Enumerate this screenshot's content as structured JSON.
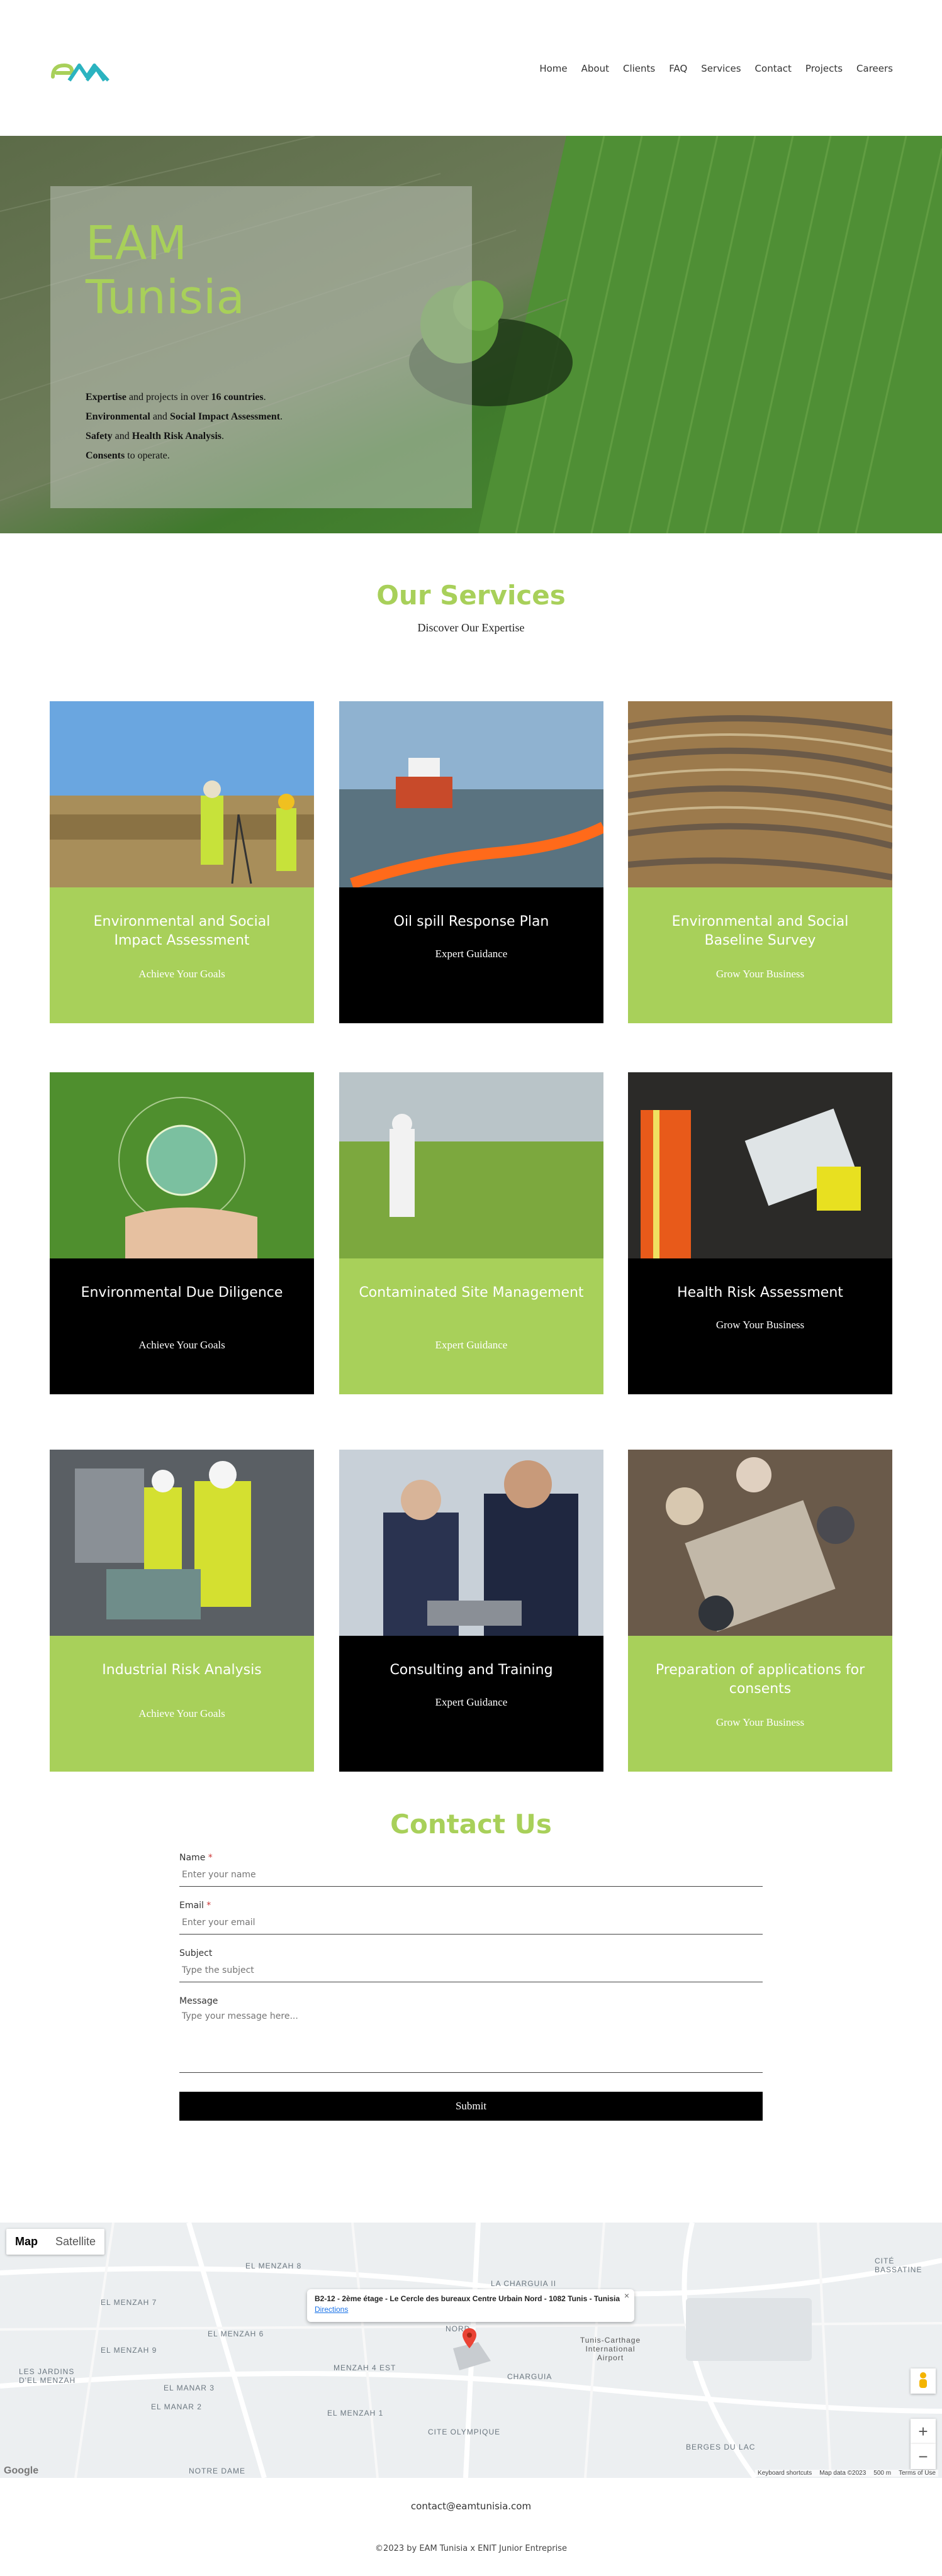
{
  "brand": {
    "logo_text": "EAM",
    "accent": "#a8d05a",
    "accent_blue": "#2bb3c0"
  },
  "nav": [
    "Home",
    "About",
    "Clients",
    "FAQ",
    "Services",
    "Contact",
    "Projects",
    "Careers"
  ],
  "hero": {
    "title_line1": "EAM",
    "title_line2": "Tunisia",
    "lines": [
      {
        "b1": "Expertise",
        "t1": " and projects in over ",
        "b2": "16 countries",
        "t2": "."
      },
      {
        "b1": "Environmental",
        "t1": " and ",
        "b2": "Social Impact Assessment",
        "t2": "."
      },
      {
        "b1": "Safety",
        "t1": " and ",
        "b2": "Health Risk Analysis",
        "t2": "."
      },
      {
        "b1": "Consents",
        "t1": " to operate.",
        "b2": "",
        "t2": ""
      }
    ]
  },
  "services": {
    "title": "Our Services",
    "subtitle": "Discover Our Expertise",
    "cards": [
      {
        "title": "Environmental and Social Impact Assessment",
        "sub": "Achieve Your Goals",
        "style": "green",
        "image": "surveyors-field"
      },
      {
        "title": "Oil spill Response Plan",
        "sub": "Expert Guidance",
        "style": "black",
        "image": "oil-boom-boat"
      },
      {
        "title": "Environmental and Social Baseline Survey",
        "sub": "Grow Your Business",
        "style": "green",
        "image": "open-pit-mine"
      },
      {
        "title": "Environmental Due Diligence",
        "sub": "Achieve Your Goals",
        "style": "black",
        "image": "globe-hand"
      },
      {
        "title": "Contaminated Site Management",
        "sub": "Expert Guidance",
        "style": "green",
        "image": "hazmat-field"
      },
      {
        "title": "Health Risk Assessment",
        "sub": "Grow Your Business",
        "style": "black",
        "image": "worker-clipboard"
      },
      {
        "title": "Industrial Risk Analysis",
        "sub": "Achieve Your Goals",
        "style": "green",
        "image": "engineers-laptop"
      },
      {
        "title": "Consulting and Training",
        "sub": "Expert Guidance",
        "style": "black",
        "image": "business-meeting"
      },
      {
        "title": "Preparation of applications for consents",
        "sub": "Grow Your Business",
        "style": "green",
        "image": "table-meeting"
      }
    ]
  },
  "contact": {
    "title": "Contact Us",
    "name_label": "Name",
    "name_placeholder": "Enter your name",
    "email_label": "Email",
    "email_placeholder": "Enter your email",
    "subject_label": "Subject",
    "subject_placeholder": "Type the subject",
    "message_label": "Message",
    "message_placeholder": "Type your message here...",
    "required_mark": "*",
    "submit": "Submit"
  },
  "map": {
    "tab_map": "Map",
    "tab_satellite": "Satellite",
    "address": "B2-12 - 2ème étage - Le Cercle des bureaux Centre Urbain Nord - 1082 Tunis - Tunisia",
    "directions": "Directions",
    "close": "×",
    "zoom_in": "+",
    "zoom_out": "−",
    "keyboard": "Keyboard shortcuts",
    "map_data": "Map data ©2023",
    "scale": "500 m",
    "terms": "Terms of Use",
    "google": "Google",
    "labels": {
      "menzah8": "EL MENZAH 8",
      "menzah7": "EL MENZAH 7",
      "menzah6": "EL MENZAH 6",
      "menzah9": "EL MENZAH 9",
      "menzah4": "MENZAH 4 EST",
      "menzah1": "EL MENZAH 1",
      "manar2": "EL MANAR 2",
      "manar3": "EL MANAR 3",
      "charguia2": "LA CHARGUIA II",
      "charguia": "CHARGUIA",
      "airport": "Tunis-Carthage International Airport",
      "olympique": "CITE OLYMPIQUE",
      "berges": "BERGES DU LAC",
      "bassatine": "CITÉ BASSATINE",
      "jardins": "LES JARDINS D'EL MENZAH",
      "notredame": "NOTRE DAME",
      "urbain": "NORD"
    }
  },
  "footer": {
    "email": "contact@eamtunisia.com",
    "copyright": "©2023 by EAM Tunisia x ENIT Junior Entreprise"
  }
}
